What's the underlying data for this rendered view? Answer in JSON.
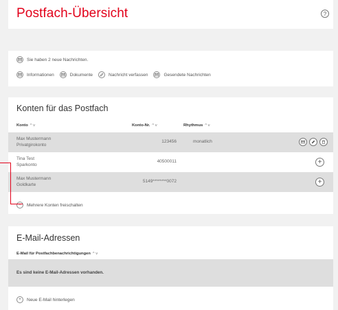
{
  "header": {
    "title": "Postfach-Übersicht",
    "help_label": "?"
  },
  "messages": {
    "new_text": "Sie haben 2 neue Nachrichten.",
    "links": [
      {
        "label": "Informationen",
        "icon": "envelope-icon"
      },
      {
        "label": "Dokumente",
        "icon": "envelope-icon"
      },
      {
        "label": "Nachricht verfassen",
        "icon": "pencil-icon"
      },
      {
        "label": "Gesendete Nachrichten",
        "icon": "envelope-icon"
      }
    ]
  },
  "accounts": {
    "title": "Konten für das Postfach",
    "columns": {
      "konto": "Konto",
      "nummer": "Konto-Nr.",
      "rhythmus": "Rhythmus",
      "sort": "^ v"
    },
    "rows": [
      {
        "name": "Max Mustermann",
        "type": "Privatgirokonto",
        "number": "123456",
        "rhythm": "monatlich",
        "shaded": true
      },
      {
        "name": "Tina Test",
        "type": "Sparkonto",
        "number": "40500011",
        "rhythm": "",
        "shaded": false
      },
      {
        "name": "Max Mustermann",
        "type": "Goldkarte",
        "number": "5149********0072",
        "rhythm": "",
        "shaded": true
      }
    ],
    "add_more": "Mehrere Konten freischalten"
  },
  "email": {
    "title": "E-Mail-Adressen",
    "column": "E-Mail für Postfachbenachrichtigungen",
    "sort": "^ v",
    "empty": "Es sind keine E-Mail-Adressen vorhanden.",
    "add": "Neue E-Mail hinterlegen"
  },
  "colors": {
    "accent": "#e2001a",
    "row_shade": "#dedede",
    "background": "#f1f1f1"
  }
}
